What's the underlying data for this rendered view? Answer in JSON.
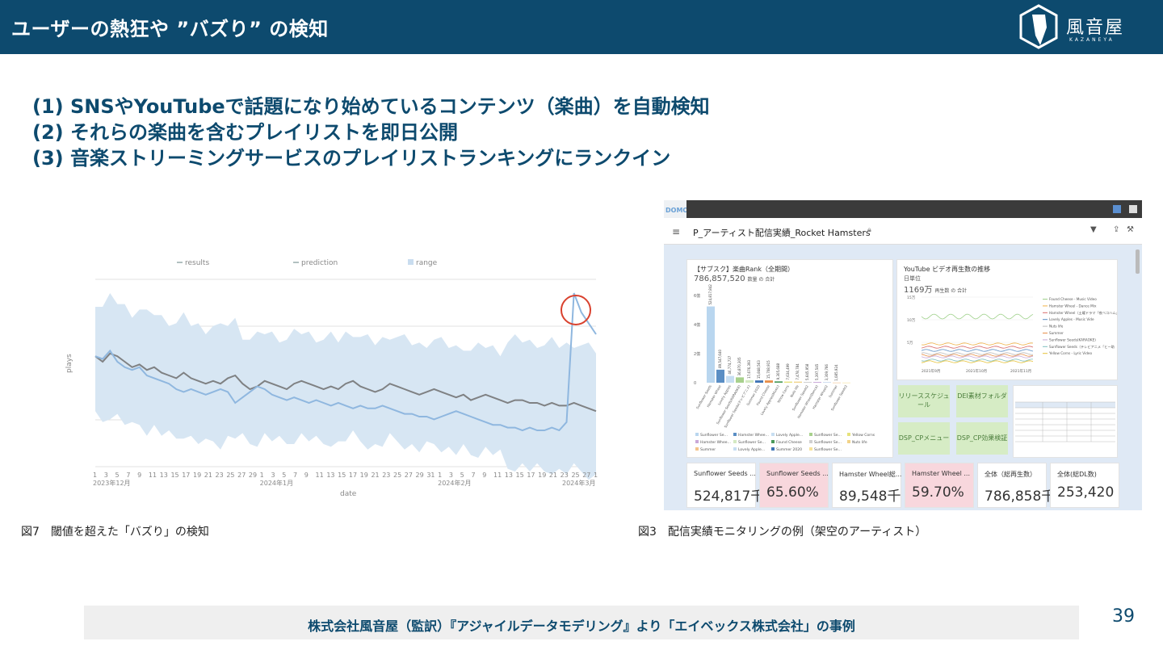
{
  "header": {
    "title": "ユーザーの熱狂や ”バズり” の検知"
  },
  "logo": {
    "name": "風音屋",
    "sub": "KAZANEYA"
  },
  "points": [
    "(1) SNSやYouTubeで話題になり始めているコンテンツ（楽曲）を自動検知",
    "(2) それらの楽曲を含むプレイリストを即日公開",
    "(3) 音楽ストリーミングサービスのプレイリストランキングにランクイン"
  ],
  "chart_data": {
    "type": "line",
    "legend": [
      "results",
      "prediction",
      "range"
    ],
    "ylabel": "plays",
    "xlabel": "date",
    "x_tick_labels": [
      "1",
      "3",
      "5",
      "7",
      "9",
      "11",
      "13",
      "15",
      "17",
      "19",
      "21",
      "23",
      "25",
      "27",
      "29",
      "1",
      "3",
      "5",
      "7",
      "9",
      "11",
      "13",
      "15",
      "17",
      "19",
      "21",
      "23",
      "25",
      "27",
      "29",
      "31",
      "1",
      "3",
      "5",
      "7",
      "9",
      "11",
      "13",
      "15",
      "17",
      "19",
      "21",
      "23",
      "25",
      "27",
      "1"
    ],
    "month_labels": [
      "2023年12月",
      "2024年1月",
      "2024年2月",
      "2024年3月"
    ],
    "series": [
      {
        "name": "results",
        "values": [
          62,
          61,
          64,
          60,
          58,
          57,
          58,
          55,
          54,
          53,
          52,
          50,
          49,
          50,
          49,
          48,
          49,
          50,
          49,
          45,
          47,
          49,
          51,
          50,
          48,
          47,
          46,
          47,
          46,
          45,
          46,
          45,
          44,
          45,
          44,
          43,
          44,
          43,
          43,
          44,
          43,
          42,
          41,
          41,
          40,
          40,
          39,
          40,
          41,
          42,
          41,
          40,
          39,
          38,
          37,
          37,
          36,
          36,
          35,
          36,
          35,
          35,
          36,
          35,
          38,
          85,
          78,
          74,
          70
        ]
      },
      {
        "name": "prediction",
        "values": [
          62,
          60,
          63,
          62,
          60,
          58,
          59,
          57,
          58,
          56,
          55,
          54,
          56,
          54,
          53,
          52,
          53,
          52,
          54,
          55,
          52,
          50,
          51,
          53,
          52,
          51,
          50,
          52,
          53,
          52,
          51,
          50,
          51,
          50,
          52,
          53,
          51,
          50,
          49,
          50,
          52,
          51,
          50,
          49,
          48,
          49,
          50,
          49,
          48,
          47,
          48,
          46,
          47,
          48,
          47,
          46,
          45,
          46,
          46,
          45,
          45,
          44,
          45,
          44,
          44,
          45,
          44,
          43,
          42
        ]
      }
    ]
  },
  "captions": {
    "fig7": "図7　閾値を超えた「バズり」の検知",
    "fig3": "図3　配信実績モニタリングの例（架空のアーティスト）"
  },
  "dashboard": {
    "logo": "DOMO",
    "title": "P_アーティスト配信実績_Rocket Hamsters",
    "rank_card": {
      "title": "【サブスク】楽曲Rank（全期間）",
      "total": "786,857,520",
      "total_suffix": "数量 の 合計",
      "chart_data": {
        "type": "bar",
        "categories": [
          "Sunflower Seeds",
          "Hamster Wheel",
          "Lovely Apples",
          "Sunflower Seeds(KARAOKE)",
          "Sunflower Seeds(テレビアニメ)",
          "Summer 2020",
          "Found Cheese",
          "Lovely Apples(Music)",
          "Yellow Corns",
          "Nuts life",
          "Sunflower Seeds2",
          "Hamster Wheel(Dance)",
          "Hamster Wheel2",
          "Summer",
          "Sunflower Seeds3"
        ],
        "values": [
          524817842,
          89547640,
          46774737,
          36870305,
          17676393,
          15848563,
          15708915,
          9305688,
          7634499,
          7478784,
          5645958,
          5397545,
          3309766,
          1085924,
          900000
        ],
        "value_labels": [
          "524,817,842",
          "89,547,640",
          "46,774,737",
          "36,870,305",
          "17,676,393",
          "15,848,563",
          "15,708,915",
          "9,305,688",
          "7,634,499",
          "7,478,784",
          "5,645,958",
          "5,397,545",
          "3,309,766",
          "1,085,924",
          ""
        ],
        "ytick_labels": [
          "6億",
          "4億",
          "2億",
          "0"
        ]
      }
    },
    "yt_card": {
      "title": "YouTube ビデオ再生数の推移",
      "sub": "日単位",
      "total": "1169万",
      "total_suffix": "再生数 の 合計",
      "ytick_labels": [
        "15万",
        "10万",
        "5万"
      ],
      "xtick_labels": [
        "2021年9月",
        "2021年10月",
        "2021年11月"
      ],
      "legend": [
        "Found Cheese - Music Video",
        "Hamster Wheel - Dance Mix",
        "Hamster Wheel（土曜ドラマ「夜ベコハム」ス チッ主題歌）",
        "Lovely Apples - Music Video",
        "Nuts life",
        "Summer",
        "Sunflower Seeds(KARAOKE)",
        "Sunflower Seeds（テレビアニメ「ヒー助の冒険」主題歌）",
        "Yellow Corns - Lyric Video"
      ]
    },
    "buttons": [
      "リリーススケジュール",
      "DEI素材フォルダ",
      "DSP_CPメニュー",
      "DSP_CP効果検証"
    ],
    "kpis": [
      {
        "label": "Sunflower Seeds ...",
        "value": "524,817千",
        "highlight": false
      },
      {
        "label": "Sunflower Seeds ...",
        "value": "65.60%",
        "highlight": true
      },
      {
        "label": "Hamster Wheel総...",
        "value": "89,548千",
        "highlight": false
      },
      {
        "label": "Hamster Wheel ...",
        "value": "59.70%",
        "highlight": true
      },
      {
        "label": "全体（総再生数）",
        "value": "786,858千",
        "highlight": false
      },
      {
        "label": "全体(総DL数)",
        "value": "253,420",
        "highlight": false
      }
    ],
    "colors": {
      "pink": "#f8d7dd",
      "green": "#d6ecc5"
    }
  },
  "footer": "株式会社風音屋（監訳）『アジャイルデータモデリング』より「エイベックス株式会社」の事例",
  "page_number": "39"
}
